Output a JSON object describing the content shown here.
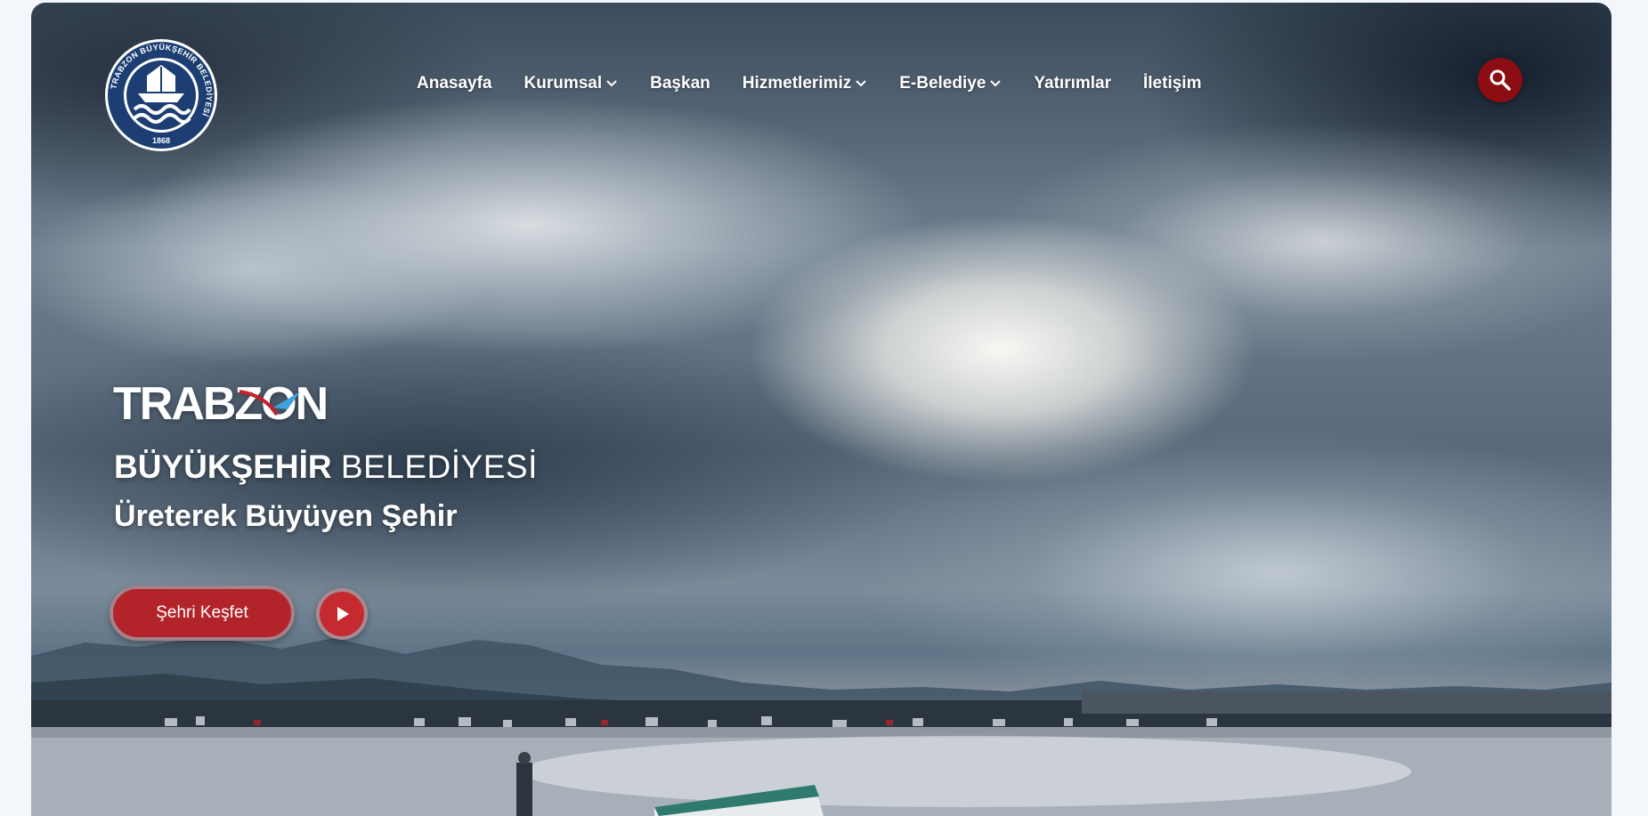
{
  "logo": {
    "ring_text": "TRABZON BÜYÜKŞEHİR BELEDİYESİ",
    "year": "1868"
  },
  "nav": {
    "items": [
      {
        "label": "Anasayfa",
        "dropdown": false
      },
      {
        "label": "Kurumsal",
        "dropdown": true
      },
      {
        "label": "Başkan",
        "dropdown": false
      },
      {
        "label": "Hizmetlerimiz",
        "dropdown": true
      },
      {
        "label": "E-Belediye",
        "dropdown": true
      },
      {
        "label": "Yatırımlar",
        "dropdown": false
      },
      {
        "label": "İletişim",
        "dropdown": false
      }
    ]
  },
  "search": {
    "icon": "search-icon"
  },
  "hero": {
    "wordmark": "TRABZON",
    "subtitle_bold": "BÜYÜKŞEHİR",
    "subtitle_light": "BELEDİYESİ",
    "slogan": "Üreterek Büyüyen Şehir",
    "cta_label": "Şehri Keşfet",
    "play_icon": "play-icon"
  },
  "colors": {
    "accent_dark_red": "#8c0d12",
    "accent_red": "#b3232a",
    "logo_navy": "#1c3e73"
  }
}
